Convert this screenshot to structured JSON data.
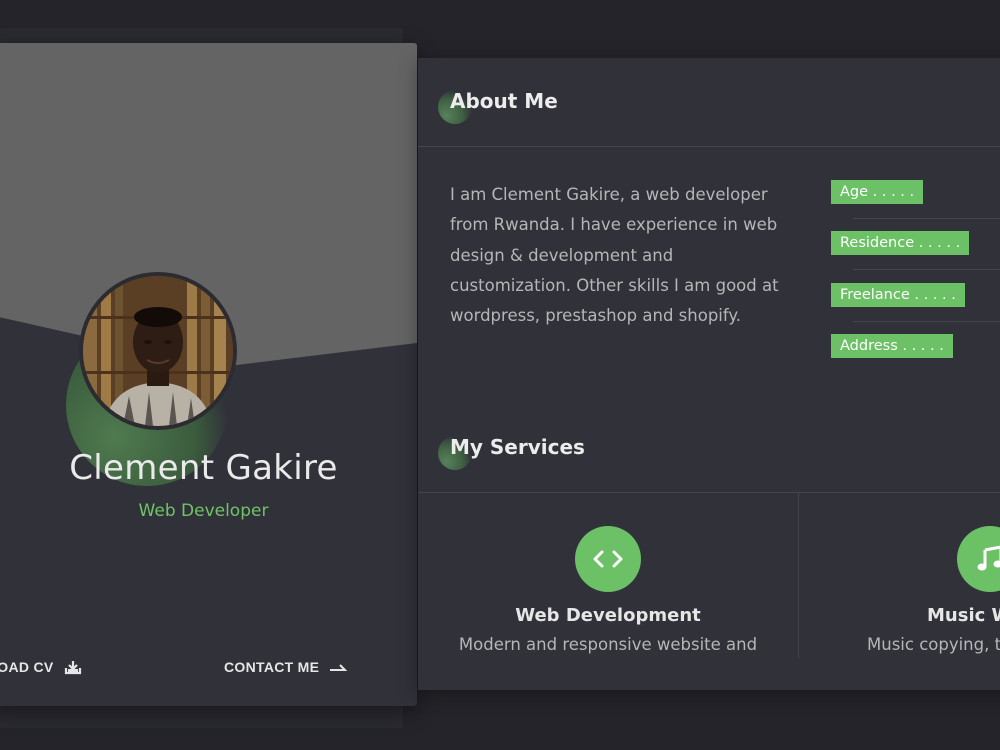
{
  "profile": {
    "name": "Clement Gakire",
    "role": "Web Developer",
    "download_label": "NLOAD CV",
    "contact_label": "CONTACT ME"
  },
  "about": {
    "title": "About Me",
    "text": "I am Clement Gakire, a web developer from Rwanda. I have experience in web design & development and customization. Other skills I am good at wordpress, prestashop and shopify.",
    "info": [
      {
        "label": "Age . . . . ."
      },
      {
        "label": "Residence . . . . ."
      },
      {
        "label": "Freelance . . . . ."
      },
      {
        "label": "Address . . . . ."
      }
    ]
  },
  "services": {
    "title": "My Services",
    "items": [
      {
        "title": "Web Development",
        "desc": "Modern and responsive website and",
        "icon": "code-icon"
      },
      {
        "title": "Music W",
        "desc": "Music copying, t",
        "icon": "music-note-icon"
      }
    ]
  },
  "colors": {
    "accent": "#6cc166",
    "background": "#24242a",
    "card": "#31313a",
    "cover": "#646464"
  }
}
